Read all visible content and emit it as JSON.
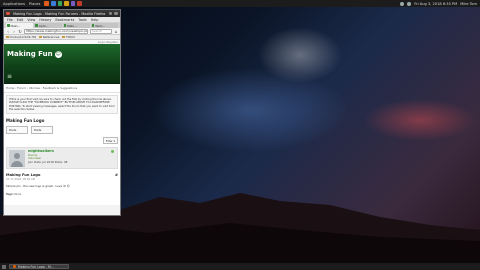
{
  "top_panel": {
    "menus": [
      "Applications",
      "Places"
    ],
    "clock": "Fri Aug 3, 2018  6:35 PM",
    "user": "Mike Tom",
    "launcher_colors": [
      "#e25c1e",
      "#3b7dd8",
      "#3aa655",
      "#d4a017",
      "#7a5bc4",
      "#c0392b"
    ]
  },
  "browser": {
    "window_title": "Making Fun Logo - Making Fun Forums - Mozilla Firefox",
    "menu": [
      "File",
      "Edit",
      "View",
      "History",
      "Bookmarks",
      "Tools",
      "Help"
    ],
    "tabs": [
      "Maki...",
      "Aphi...",
      "Maki...",
      "Welc..."
    ],
    "url": "https://www.makingfun.com/viewtopic.php",
    "search_placeholder": "Search",
    "bookmarks": [
      "OculusContrib HQ",
      "References",
      "TODO"
    ]
  },
  "page": {
    "login_link": "Login  Register",
    "logo_text": "Making Fun",
    "breadcrumb": "Home › Forum › Idiomes › Feedback & Suggestions",
    "notice": "If this is your first visit, be sure to check out the FAQ by clicking the link above. PLEASE CLICK THE \"FACEBOOK CONNECT\" BUTTON ABOVE TO LOGIN BEFORE POSTING. To start viewing messages, select the forum that you want to visit from the selection below.",
    "thread_title": "Making Fun Logo",
    "pager_left": "Posts",
    "pager_right": "Posts",
    "filter_label": "Filter ▾",
    "post": {
      "username": "mightwalkers",
      "rank_line1": "Rookie",
      "rank_line2": "Volunteer",
      "join_info": "Join Date: Jul 2018   Posts: 48",
      "title": "Making Fun Logo",
      "date": "07-17-2018, 08:49 AM",
      "text": "Simple pic.. the new logo is great - Love it!",
      "tags_label": "Tags:",
      "tags_value": "None"
    }
  },
  "bottom_panel": {
    "task_label": "Making Fun Logo - M..."
  }
}
